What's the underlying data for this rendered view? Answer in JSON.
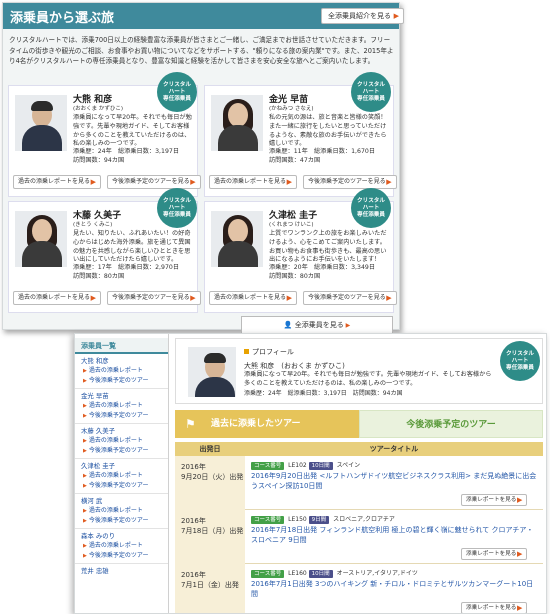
{
  "top": {
    "title": "添乗員から選ぶ旅",
    "all_intro_button": "全添乗員紹介を見る",
    "intro": "クリスタルハートでは、添乗700日以上の経験豊富な添乗員が皆さまとご一緒し、ご満足までお世話させていただきます。フリータイムの街歩きや観光のご相談、お食事やお買い物についてなどをサポートする、\"頼りになる旅の案内業\"です。また、2015年より4名がクリスタルハートの専任添乗員となり、豊富な知識と経験を活かして皆さまを安心安全な旅へとご案内いたします。",
    "badge_text": [
      "クリスタル",
      "ハート",
      "専任添乗員"
    ],
    "past_report_label": "過去の添乗レポートを見る",
    "future_tour_label": "今後添乗予定のツアーを見る",
    "all_guides_button": "全添乗員を見る",
    "guides": [
      {
        "name": "大熊 和彦",
        "kana": "(おおくま かずひこ)",
        "desc": "添乗員になって早20年。それでも毎日が勉強です。先輩や現地ガイド、そしてお客様から多くのことを教えていただけるのは、私の楽しみの一つです。",
        "stat1": "添乗歴：24年　総添乗日数：3,197日",
        "stat2": "訪問国数：94カ国"
      },
      {
        "name": "金光 早苗",
        "kana": "(かねみつ さなえ)",
        "desc": "私の元気の源は、旅と音楽と皆様の笑顔！また一緒に旅行をしたいと思っていただけるような、素敵な旅のお手伝いができたら嬉しいです。",
        "stat1": "添乗歴：11年　総添乗日数：1,670日",
        "stat2": "訪問国数：47カ国"
      },
      {
        "name": "木藤 久美子",
        "kana": "(きとう くみこ)",
        "desc": "見たい、知りたい、ふれあいたい！の好奇心からはじめた海外添乗。旅を通じて異国の魅力を共感しながら楽しいひとときを思い出にしていただけたら嬉しいです。",
        "stat1": "添乗歴：17年　総添乗日数：2,970日",
        "stat2": "訪問国数：80カ国"
      },
      {
        "name": "久津松 圭子",
        "kana": "(くれまつ けいこ)",
        "desc": "上質でワンランク上の旅をお楽しみいただけるよう、心をこめてご案内いたします。お買い物もお食事も街歩きも、最高の思い出になるようにお手伝いをいたします！",
        "stat1": "添乗歴：20年　総添乗日数：3,349日",
        "stat2": "訪問国数：80カ国"
      }
    ]
  },
  "bottom": {
    "sidebar_title": "添乗員一覧",
    "sidebar_link_past": "過去の添乗レポート",
    "sidebar_link_future": "今後添乗予定のツアー",
    "sidebar_names": [
      "大熊 和彦",
      "金光 早苗",
      "木藤 久美子",
      "久津松 圭子",
      "横河 武",
      "森本 みのり",
      "荒井 忠雄"
    ],
    "profile_label": "プロフィール",
    "profile_name": "大熊 和彦　(おおくま かずひこ)",
    "profile_desc": "添乗員になって早20年。それでも毎日が勉強です。先輩や現地ガイド、そしてお客様から多くのことを教えていただけるのは、私の楽しみの一つです。",
    "profile_stats": "添乗歴：24年　総添乗日数：3,197日　訪問国数：94カ国",
    "tab_past": "過去に添乗したツアー",
    "tab_future": "今後添乗予定のツアー",
    "col_date": "出発日",
    "col_title": "ツアータイトル",
    "course_chip": "コース番号",
    "day_chip": "日数",
    "report_button": "添乗レポートを見る",
    "rows": [
      {
        "year": "2016年",
        "date": "9月20日（火）出発",
        "code": "LE102",
        "days": "10日間",
        "country": "スペイン",
        "title": "2016年9月20日出発 <ルフトハンザドイツ航空ビジネスクラス利用> まだ見ぬ絶景に出会うスペイン探訪10日間"
      },
      {
        "year": "2016年",
        "date": "7月18日（月）出発",
        "code": "LE150",
        "days": "9日間",
        "country": "スロベニア,クロアチア",
        "title": "2016年7月18日出発 フィンランド航空利用 極上の碧と輝く嶺に魅せられて クロアチア・スロベニア 9日間"
      },
      {
        "year": "2016年",
        "date": "7月1日（金）出発",
        "code": "LE160",
        "days": "10日間",
        "country": "オーストリア,イタリア,ドイツ",
        "title": "2016年7月1日出発 3つのハイキング 新・チロル・ドロミテとザルツカンマーグート10日間"
      }
    ]
  }
}
